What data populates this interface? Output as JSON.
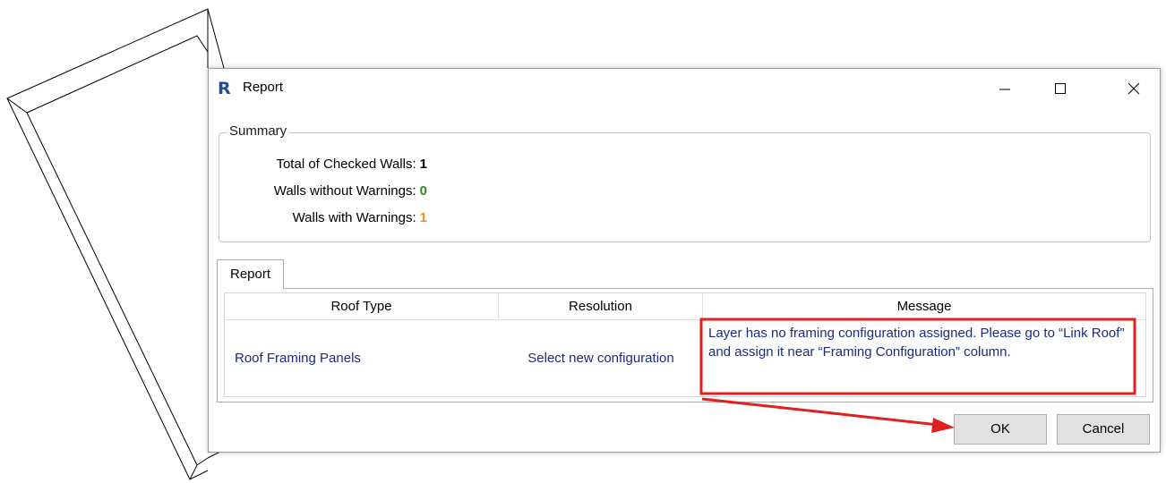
{
  "window": {
    "title": "Report",
    "app_icon_glyph": "R",
    "controls": [
      "minimize-icon",
      "maximize-icon",
      "close-icon"
    ]
  },
  "summary": {
    "legend": "Summary",
    "rows": [
      {
        "label": "Total of Checked Walls:",
        "value": "1",
        "color": "#000000"
      },
      {
        "label": "Walls without Warnings:",
        "value": "0",
        "color": "#2e8b1e"
      },
      {
        "label": "Walls with Warnings:",
        "value": "1",
        "color": "#f08a24"
      }
    ]
  },
  "report_tab": {
    "label": "Report",
    "columns": [
      "Roof Type",
      "Resolution",
      "Message"
    ],
    "rows": [
      {
        "roof_type": "Roof Framing Panels",
        "resolution": "Select new configuration",
        "message": "Layer has no framing configuration assigned. Please go to “Link Roof” and assign it near “Framing Configuration” column."
      }
    ]
  },
  "buttons": {
    "ok": "OK",
    "cancel": "Cancel"
  },
  "colors": {
    "annotation": "#e02020",
    "link_text": "#1a2b84",
    "app_icon": "#1e4f8f"
  }
}
